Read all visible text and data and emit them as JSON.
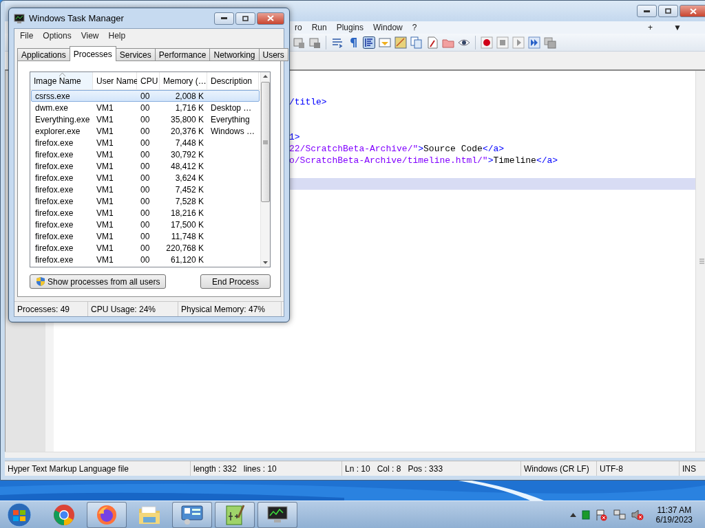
{
  "editor_window": {
    "menu": [
      "ro",
      "Run",
      "Plugins",
      "Window",
      "?"
    ],
    "menu_right": [
      "+",
      "▼"
    ],
    "code_lines": [
      {
        "current": false
      },
      {
        "current": false
      },
      {
        "current": false,
        "segments": [
          {
            "kind": "tag",
            "text": "/title>"
          }
        ]
      },
      {
        "current": false
      },
      {
        "current": false
      },
      {
        "current": false,
        "segments": [
          {
            "kind": "tag",
            "text": "1>"
          }
        ]
      },
      {
        "current": false,
        "segments": [
          {
            "kind": "string",
            "text": "22/ScratchBeta-Archive/\""
          },
          {
            "kind": "tag",
            "text": ">"
          },
          {
            "kind": "text",
            "text": "Source Code"
          },
          {
            "kind": "tag",
            "text": "</a>"
          }
        ]
      },
      {
        "current": false,
        "segments": [
          {
            "kind": "string",
            "text": "o/ScratchBeta-Archive/timeline.html/\""
          },
          {
            "kind": "tag",
            "text": ">"
          },
          {
            "kind": "text",
            "text": "Timeline"
          },
          {
            "kind": "tag",
            "text": "</a>"
          }
        ]
      },
      {
        "current": false
      },
      {
        "current": true
      }
    ],
    "status_bar": [
      [
        "Hyper Text Markup Language file"
      ],
      [
        "length : 332",
        "lines : 10"
      ],
      [
        "Ln : 10",
        "Col : 8",
        "Pos : 333"
      ],
      [
        "Windows (CR LF)"
      ],
      [
        "UTF-8"
      ],
      [
        "INS"
      ]
    ]
  },
  "task_manager": {
    "title": "Windows Task Manager",
    "menu": [
      "File",
      "Options",
      "View",
      "Help"
    ],
    "tabs": [
      {
        "label": "Applications",
        "selected": false
      },
      {
        "label": "Processes",
        "selected": true
      },
      {
        "label": "Services",
        "selected": false
      },
      {
        "label": "Performance",
        "selected": false
      },
      {
        "label": "Networking",
        "selected": false
      },
      {
        "label": "Users",
        "selected": false
      }
    ],
    "columns": [
      "Image Name",
      "User Name",
      "CPU",
      "Memory (…",
      "Description"
    ],
    "rows": [
      {
        "image": "csrss.exe",
        "cpu": "00",
        "memory": "2,008 K",
        "selected": true
      },
      {
        "image": "dwm.exe",
        "user": "VM1",
        "cpu": "00",
        "memory": "1,716 K",
        "description": "Desktop …",
        "selected": false
      },
      {
        "image": "Everything.exe",
        "user": "VM1",
        "cpu": "00",
        "memory": "35,800 K",
        "description": "Everything",
        "selected": false
      },
      {
        "image": "explorer.exe",
        "user": "VM1",
        "cpu": "00",
        "memory": "20,376 K",
        "description": "Windows …",
        "selected": false
      },
      {
        "image": "firefox.exe",
        "user": "VM1",
        "cpu": "00",
        "memory": "7,448 K",
        "selected": false
      },
      {
        "image": "firefox.exe",
        "user": "VM1",
        "cpu": "00",
        "memory": "30,792 K",
        "selected": false
      },
      {
        "image": "firefox.exe",
        "user": "VM1",
        "cpu": "00",
        "memory": "48,412 K",
        "selected": false
      },
      {
        "image": "firefox.exe",
        "user": "VM1",
        "cpu": "00",
        "memory": "3,624 K",
        "selected": false
      },
      {
        "image": "firefox.exe",
        "user": "VM1",
        "cpu": "00",
        "memory": "7,452 K",
        "selected": false
      },
      {
        "image": "firefox.exe",
        "user": "VM1",
        "cpu": "00",
        "memory": "7,528 K",
        "selected": false
      },
      {
        "image": "firefox.exe",
        "user": "VM1",
        "cpu": "00",
        "memory": "18,216 K",
        "selected": false
      },
      {
        "image": "firefox.exe",
        "user": "VM1",
        "cpu": "00",
        "memory": "17,500 K",
        "selected": false
      },
      {
        "image": "firefox.exe",
        "user": "VM1",
        "cpu": "00",
        "memory": "11,748 K",
        "selected": false
      },
      {
        "image": "firefox.exe",
        "user": "VM1",
        "cpu": "00",
        "memory": "220,768 K",
        "selected": false
      },
      {
        "image": "firefox.exe",
        "user": "VM1",
        "cpu": "00",
        "memory": "61,120 K",
        "selected": false
      }
    ],
    "buttons": [
      "Show processes from all users",
      "End Process"
    ],
    "status_bar": [
      "Processes: 49",
      "CPU Usage: 24%",
      "Physical Memory: 47%"
    ]
  },
  "taskbar": {
    "apps": [
      {
        "kind": "chrome",
        "running": false
      },
      {
        "kind": "firefox",
        "running": true
      },
      {
        "kind": "folder",
        "running": false
      },
      {
        "kind": "control",
        "running": true
      },
      {
        "kind": "notepad",
        "running": true
      },
      {
        "kind": "monitor",
        "running": true
      }
    ],
    "time": "11:37 AM",
    "date": "6/19/2023"
  }
}
